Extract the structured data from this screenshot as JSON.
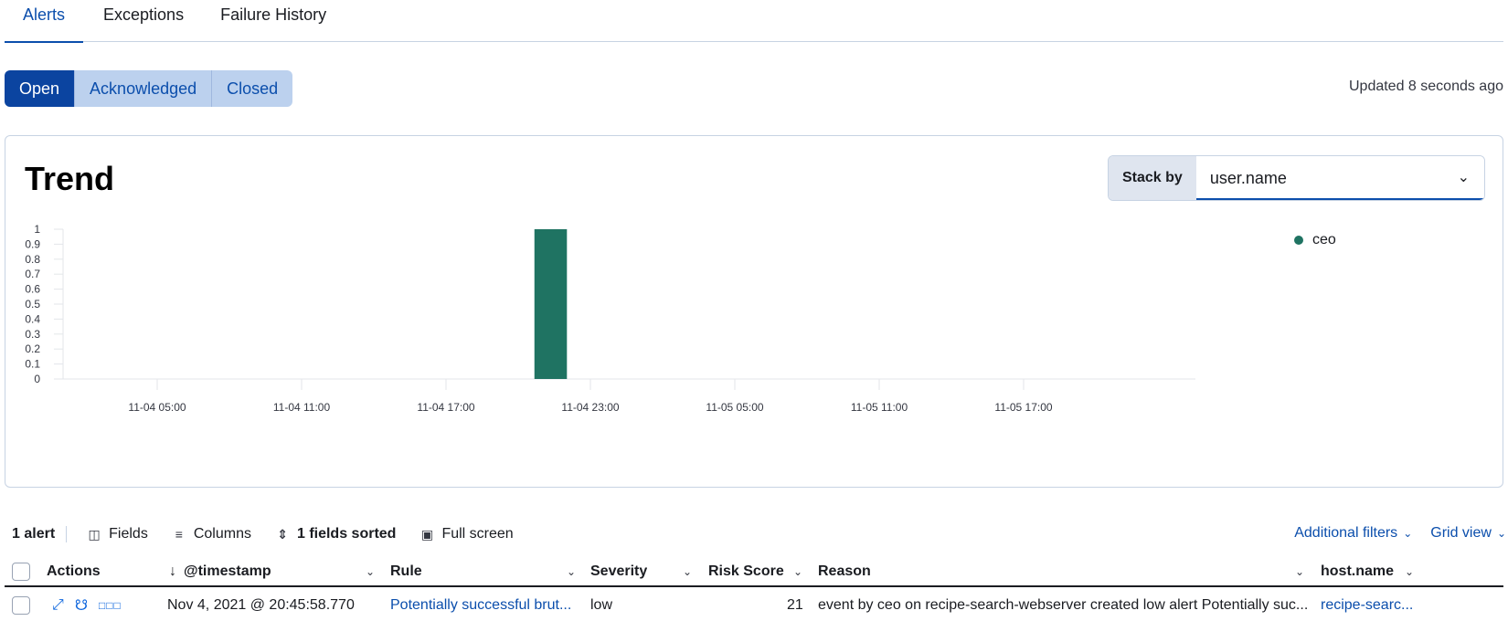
{
  "tabs": [
    {
      "label": "Alerts",
      "active": true
    },
    {
      "label": "Exceptions",
      "active": false
    },
    {
      "label": "Failure History",
      "active": false
    }
  ],
  "status_filter": {
    "options": [
      "Open",
      "Acknowledged",
      "Closed"
    ],
    "selected": "Open"
  },
  "updated_text": "Updated 8 seconds ago",
  "trend": {
    "title": "Trend",
    "stack_by_label": "Stack by",
    "stack_by_value": "user.name",
    "legend": [
      {
        "label": "ceo",
        "color": "#1f7362"
      }
    ]
  },
  "chart_data": {
    "type": "bar",
    "title": "Trend",
    "xlabel": "",
    "ylabel": "",
    "x_ticks": [
      "11-04 05:00",
      "11-04 11:00",
      "11-04 17:00",
      "11-04 23:00",
      "11-05 05:00",
      "11-05 11:00",
      "11-05 17:00"
    ],
    "y_ticks": [
      "0",
      "0.1",
      "0.2",
      "0.3",
      "0.4",
      "0.5",
      "0.6",
      "0.7",
      "0.8",
      "0.9",
      "1"
    ],
    "ylim": [
      0,
      1
    ],
    "xlim_hours_from_11_04_01_00": [
      0,
      47
    ],
    "series": [
      {
        "name": "ceo",
        "color": "#1f7362",
        "points": [
          {
            "x": "11-04 20:45",
            "hour_offset": 19.75,
            "width_hours": 1.35,
            "value": 1
          }
        ]
      }
    ],
    "legend_position": "top-right",
    "grid": false
  },
  "table": {
    "count_label": "1 alert",
    "toolbar": {
      "fields": "Fields",
      "columns": "Columns",
      "sorted": "1 fields sorted",
      "fullscreen": "Full screen"
    },
    "additional_filters": "Additional filters",
    "grid_view": "Grid view",
    "columns": [
      "Actions",
      "@timestamp",
      "Rule",
      "Severity",
      "Risk Score",
      "Reason",
      "host.name"
    ],
    "rows": [
      {
        "timestamp": "Nov 4, 2021 @ 20:45:58.770",
        "rule": "Potentially successful brut...",
        "severity": "low",
        "risk_score": "21",
        "reason": "event by ceo on recipe-search-webserver created low alert Potentially suc...",
        "host_name": "recipe-searc..."
      }
    ]
  }
}
